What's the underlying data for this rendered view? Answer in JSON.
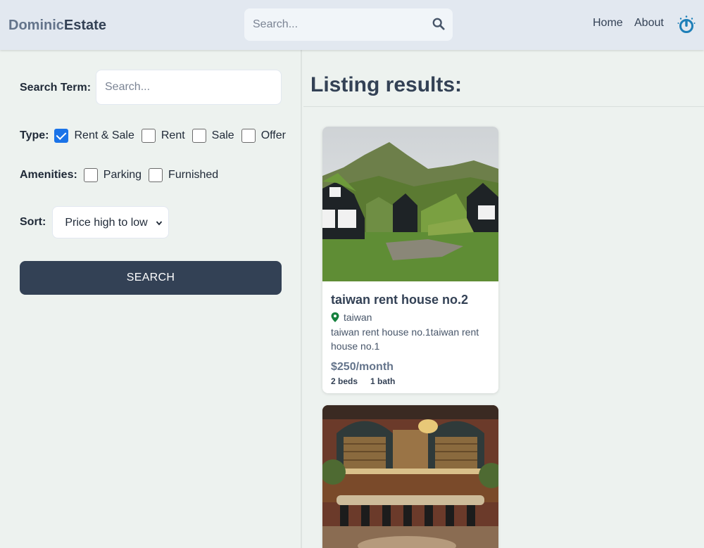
{
  "header": {
    "logo_part1": "Dominic",
    "logo_part2": "Estate",
    "search_placeholder": "Search...",
    "nav": {
      "home": "Home",
      "about": "About"
    }
  },
  "filters": {
    "search_term_label": "Search Term:",
    "search_term_placeholder": "Search...",
    "search_term_value": "",
    "type_label": "Type:",
    "type_options": [
      {
        "label": "Rent & Sale",
        "checked": true
      },
      {
        "label": "Rent",
        "checked": false
      },
      {
        "label": "Sale",
        "checked": false
      },
      {
        "label": "Offer",
        "checked": false
      }
    ],
    "amenities_label": "Amenities:",
    "amenity_options": [
      {
        "label": "Parking",
        "checked": false
      },
      {
        "label": "Furnished",
        "checked": false
      }
    ],
    "sort_label": "Sort:",
    "sort_selected": "Price high to low",
    "search_button": "SEARCH"
  },
  "results": {
    "title": "Listing results:",
    "listings": [
      {
        "name": "taiwan rent house no.2",
        "location": "taiwan",
        "description": "taiwan rent house no.1taiwan rent house no.1",
        "price": "$250/month",
        "beds": "2 beds",
        "baths": "1 bath",
        "image": "turf-roof-houses-photo"
      },
      {
        "image": "restaurant-bar-interior-photo"
      }
    ]
  },
  "colors": {
    "page_bg": "#edf2ef",
    "header_bg": "#e2e8f0",
    "primary": "#334155",
    "accent_checkbox": "#1a73e8",
    "pin": "#15803d",
    "avatar": "#1e7fb8"
  }
}
